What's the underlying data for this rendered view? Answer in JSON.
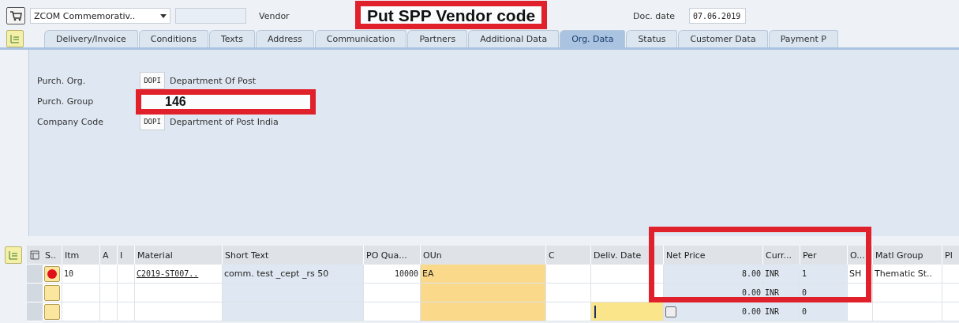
{
  "header": {
    "order_type": "ZCOM Commemorativ..",
    "vendor_label": "Vendor",
    "doc_date_label": "Doc. date",
    "doc_date": "07.06.2019"
  },
  "tabs": [
    {
      "label": "Delivery/Invoice",
      "selected": false
    },
    {
      "label": "Conditions",
      "selected": false
    },
    {
      "label": "Texts",
      "selected": false
    },
    {
      "label": "Address",
      "selected": false
    },
    {
      "label": "Communication",
      "selected": false
    },
    {
      "label": "Partners",
      "selected": false
    },
    {
      "label": "Additional Data",
      "selected": false
    },
    {
      "label": "Org. Data",
      "selected": true
    },
    {
      "label": "Status",
      "selected": false
    },
    {
      "label": "Customer Data",
      "selected": false
    },
    {
      "label": "Payment P",
      "selected": false
    }
  ],
  "org_fields": [
    {
      "label": "Purch. Org.",
      "code": "DOPI",
      "description": "Department Of Post"
    },
    {
      "label": "Purch. Group"
    },
    {
      "label": "Company Code",
      "code": "DOPI",
      "description": "Department of Post India"
    }
  ],
  "annotations": [
    {
      "text": "Put SPP Vendor code"
    },
    {
      "text": "146"
    }
  ],
  "table": {
    "columns": [
      "S..",
      "Itm",
      "A",
      "I",
      "Material",
      "Short Text",
      "PO Qua...",
      "OUn",
      "C",
      "Deliv. Date",
      "Net Price",
      "Curr...",
      "Per",
      "O...",
      "Matl Group",
      "Pl"
    ],
    "rows": [
      {
        "kind": "error",
        "editing": false,
        "cells": [
          "",
          "10",
          "",
          "",
          "C2019-ST007..",
          "comm. test _cept _rs 50",
          "10000",
          "EA",
          "",
          "",
          "8.00",
          "INR",
          "1",
          "SH",
          "Thematic St..",
          ""
        ]
      },
      {
        "kind": "empty",
        "editing": false,
        "cells": [
          "",
          "",
          "",
          "",
          "",
          "",
          "",
          "",
          "",
          "",
          "0.00",
          "INR",
          "0",
          "",
          "",
          ""
        ]
      },
      {
        "kind": "empty",
        "editing": true,
        "cells": [
          "",
          "",
          "",
          "",
          "",
          "",
          "",
          "",
          "",
          "",
          "0.00",
          "INR",
          "0",
          "",
          "",
          ""
        ]
      }
    ]
  }
}
